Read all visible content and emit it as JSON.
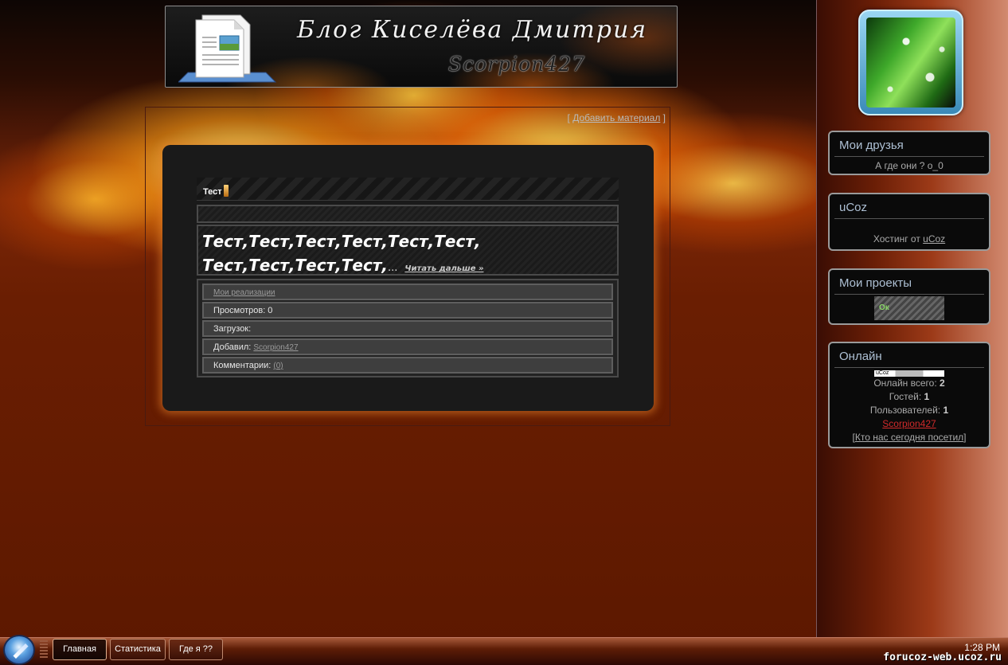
{
  "header": {
    "title": "Блог Киселёва Дмитрия",
    "subtitle": "Scorpion427"
  },
  "content": {
    "add_material_open": "[ ",
    "add_material_label": "Добавить материал",
    "add_material_close": " ]",
    "entry": {
      "title": "Тест",
      "body_line1": "Тест,Тест,Тест,Тест,Тест,Тест,",
      "body_line2": "Тест,Тест,Тест,Тест,",
      "ellipsis": "...",
      "read_more": "Читать дальше »",
      "category": "Мои реализации",
      "views_label": "Просмотров: 0",
      "downloads_label": "Загрузок:",
      "added_by_label": "Добавил: ",
      "added_by_user": "Scorpion427",
      "comments_label": "Комментарии: ",
      "comments_count": "(0)"
    }
  },
  "sidebar": {
    "avatar_icon": "green-leaf-avatar",
    "friends": {
      "title": "Мои друзья",
      "text": "А где они ? о_0"
    },
    "ucoz": {
      "title": "uCoz",
      "text": "Хостинг от ",
      "link": "uCoz"
    },
    "projects": {
      "title": "Мои проекты",
      "badge_text": "Ок"
    },
    "online": {
      "title": "Онлайн",
      "counter_text": "uCoz",
      "total_label": "Онлайн всего: ",
      "total_value": "2",
      "guests_label": "Гостей: ",
      "guests_value": "1",
      "users_label": "Пользователей: ",
      "users_value": "1",
      "user_name": "Scorpion427",
      "today_open": "[",
      "today_link": "Кто нас сегодня посетил",
      "today_close": "]"
    }
  },
  "taskbar": {
    "buttons": [
      "Главная",
      "Статистика",
      "Где я ??"
    ],
    "clock": "1:28 PM",
    "watermark": "forucoz-web.ucoz.ru"
  },
  "colors": {
    "user_link": "#d12a2a",
    "block_title": "#aec0d4",
    "panel_glow": "#e6822a"
  }
}
